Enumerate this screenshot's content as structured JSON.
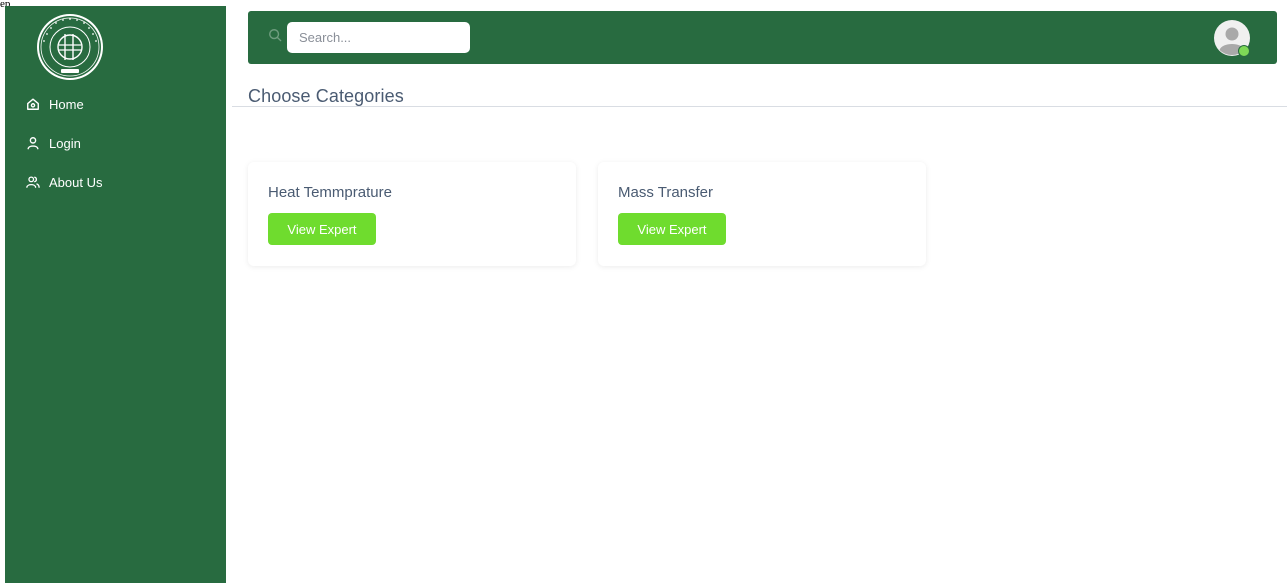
{
  "page_label": "ep",
  "sidebar": {
    "items": [
      {
        "label": "Home",
        "icon": "home-icon"
      },
      {
        "label": "Login",
        "icon": "user-icon"
      },
      {
        "label": "About Us",
        "icon": "users-icon"
      }
    ]
  },
  "header": {
    "search_placeholder": "Search...",
    "search_icon": "search-icon",
    "avatar_icon": "avatar-icon",
    "online_status_color": "#7ed957"
  },
  "main": {
    "title": "Choose Categories",
    "cards": [
      {
        "title": "Heat Temmprature",
        "button_label": "View Expert"
      },
      {
        "title": "Mass Transfer",
        "button_label": "View Expert"
      }
    ]
  },
  "colors": {
    "primary": "#286b40",
    "accent": "#6fdc2e",
    "text": "#4a5b72"
  }
}
